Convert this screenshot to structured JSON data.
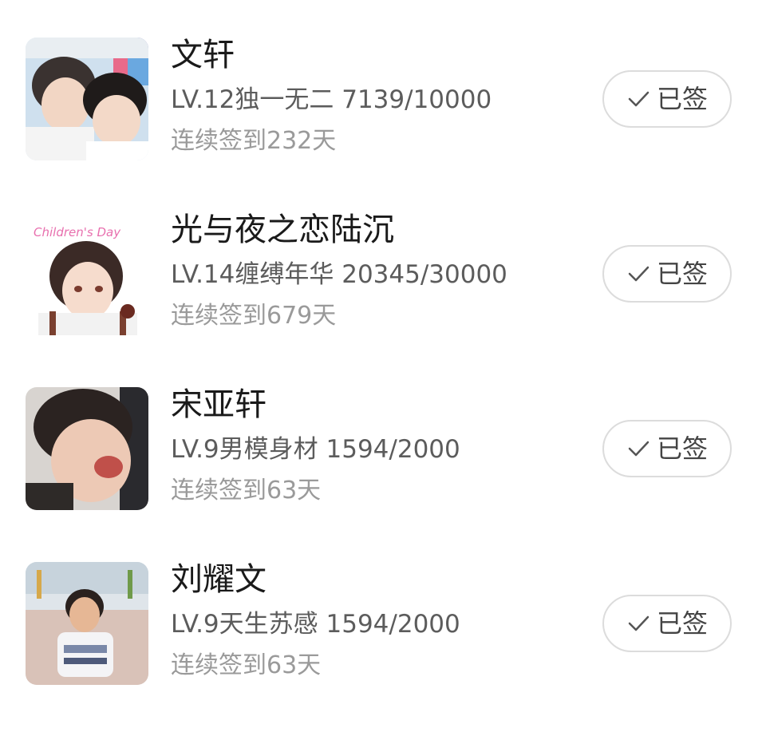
{
  "users": [
    {
      "name": "文轩",
      "level": "LV.12独一无二 7139/10000",
      "streak": "连续签到232天",
      "button_label": "已签",
      "avatar_icon": "photo-two-boys"
    },
    {
      "name": "光与夜之恋陆沉",
      "level": "LV.14缠缚年华 20345/30000",
      "streak": "连续签到679天",
      "button_label": "已签",
      "avatar_icon": "anime-boy-childrens-day",
      "avatar_caption": "Children's Day"
    },
    {
      "name": "宋亚轩",
      "level": "LV.9男模身材 1594/2000",
      "streak": "连续签到63天",
      "button_label": "已签",
      "avatar_icon": "photo-laughing-boy"
    },
    {
      "name": "刘耀文",
      "level": "LV.9天生苏感 1594/2000",
      "streak": "连续签到63天",
      "button_label": "已签",
      "avatar_icon": "photo-boy-outdoors"
    }
  ],
  "colors": {
    "name_text": "#1a1a1a",
    "level_text": "#5c5c5c",
    "streak_text": "#9a9a9a",
    "button_border": "#dcdcdc"
  }
}
